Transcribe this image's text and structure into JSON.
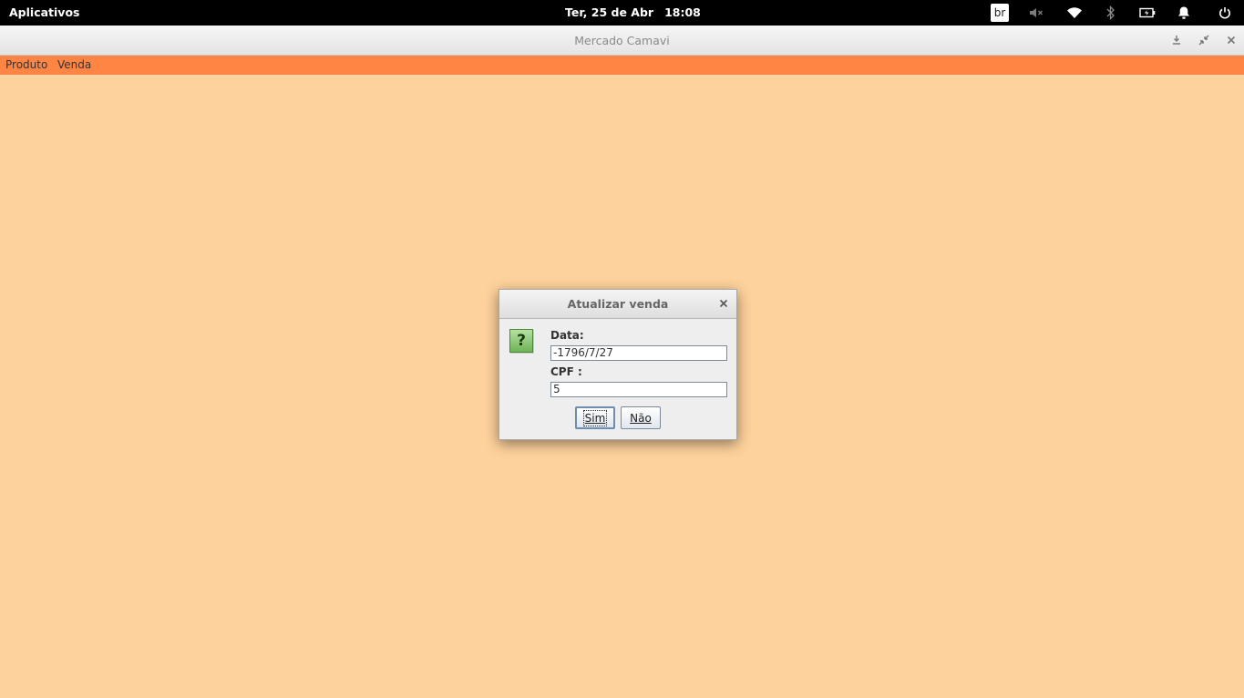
{
  "panel": {
    "applications_label": "Aplicativos",
    "date": "Ter, 25 de Abr",
    "time": "18:08",
    "keyboard_layout": "br",
    "icons": [
      "keyboard-layout-icon",
      "volume-muted-icon",
      "wifi-icon",
      "bluetooth-icon",
      "battery-icon",
      "notification-bell-icon",
      "power-icon"
    ]
  },
  "window": {
    "title": "Mercado Camavi",
    "controls": [
      "minimize-icon",
      "restore-icon",
      "close-icon"
    ]
  },
  "menu": {
    "items": [
      {
        "label": "Produto"
      },
      {
        "label": "Venda"
      }
    ]
  },
  "dialog": {
    "title": "Atualizar venda",
    "icon": "question-icon",
    "icon_glyph": "?",
    "data_label": "Data:",
    "data_value": "-1796/7/27",
    "cpf_label": "CPF :",
    "cpf_value": "5",
    "yes_button": "Sim",
    "no_button": "Não"
  },
  "colors": {
    "menubar": "#ff8545",
    "content_background": "#fed29c"
  }
}
